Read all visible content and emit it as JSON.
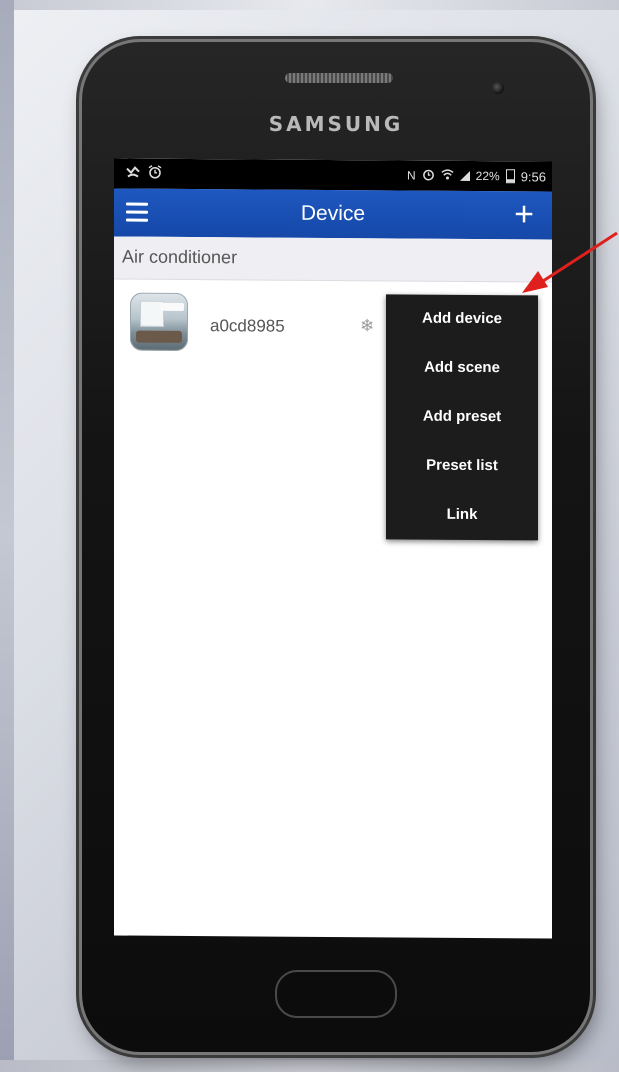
{
  "device_brand": "SAMSUNG",
  "status_bar": {
    "left_icons": [
      "missed-call-icon",
      "alarm-icon"
    ],
    "nfc": "N",
    "battery": "22%",
    "time": "9:56"
  },
  "app_bar": {
    "title": "Device",
    "add_label": "+"
  },
  "category": {
    "label": "Air conditioner"
  },
  "devices": [
    {
      "name": "a0cd8985",
      "icon": "snowflake-icon"
    }
  ],
  "menu": {
    "items": [
      "Add device",
      "Add scene",
      "Add preset",
      "Preset list",
      "Link"
    ]
  },
  "colors": {
    "app_bar": "#1a50b4",
    "menu_bg": "#1c1c1c",
    "arrow": "#e0201c"
  }
}
